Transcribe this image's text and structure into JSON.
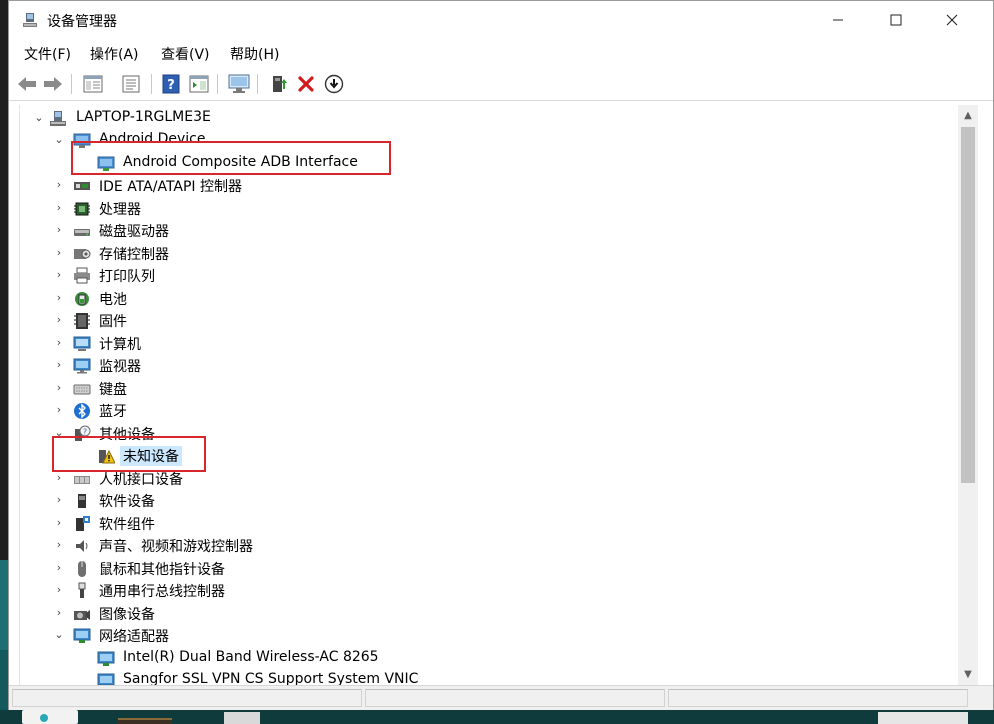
{
  "window": {
    "title": "设备管理器"
  },
  "menu": [
    "文件(F)",
    "操作(A)",
    "查看(V)",
    "帮助(H)"
  ],
  "toolbar": {
    "buttons": [
      "back-icon",
      "forward-icon",
      "properties-pane-icon",
      "show-hidden-icon",
      "help-icon",
      "action-pane-icon",
      "monitor-scan-icon",
      "update-driver-icon",
      "uninstall-icon",
      "disable-device-icon"
    ]
  },
  "tree": {
    "root": "LAPTOP-1RGLME3E",
    "items": [
      {
        "label": "Android Device",
        "expanded": true
      },
      {
        "label": "Android Composite ADB Interface",
        "child": true
      },
      {
        "label": "IDE ATA/ATAPI 控制器"
      },
      {
        "label": "处理器"
      },
      {
        "label": "磁盘驱动器"
      },
      {
        "label": "存储控制器"
      },
      {
        "label": "打印队列"
      },
      {
        "label": "电池"
      },
      {
        "label": "固件"
      },
      {
        "label": "计算机"
      },
      {
        "label": "监视器"
      },
      {
        "label": "键盘"
      },
      {
        "label": "蓝牙"
      },
      {
        "label": "其他设备",
        "expanded": true
      },
      {
        "label": "未知设备",
        "child": true,
        "selected": true
      },
      {
        "label": "人机接口设备"
      },
      {
        "label": "软件设备"
      },
      {
        "label": "软件组件"
      },
      {
        "label": "声音、视频和游戏控制器"
      },
      {
        "label": "鼠标和其他指针设备"
      },
      {
        "label": "通用串行总线控制器"
      },
      {
        "label": "图像设备"
      },
      {
        "label": "网络适配器",
        "expanded": true
      },
      {
        "label": "Intel(R) Dual Band Wireless-AC 8265",
        "child": true
      },
      {
        "label": "Sangfor SSL VPN CS Support System VNIC",
        "child": true
      }
    ]
  },
  "colors": {
    "highlight_box": "#d9262c",
    "selection": "#cce8ff",
    "desktop": "#1f6f72"
  }
}
